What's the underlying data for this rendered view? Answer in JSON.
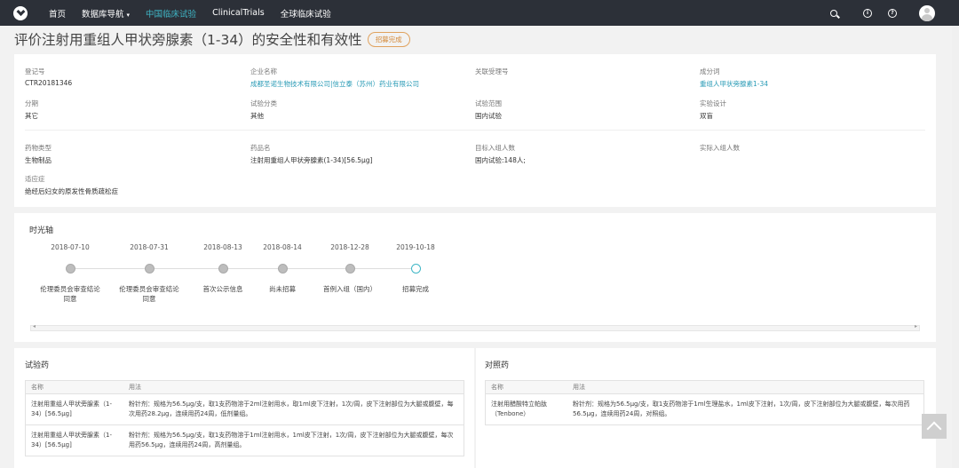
{
  "nav": {
    "home": "首页",
    "db_nav": "数据库导航",
    "china_trials": "中国临床试验",
    "clinicaltrials": "ClinicalTrials",
    "global_trials": "全球临床试验"
  },
  "page": {
    "title": "评价注射用重组人甲状旁腺素（1-34）的安全性和有效性",
    "status_badge": "招募完成"
  },
  "info": {
    "reg_no_label": "登记号",
    "reg_no": "CTR20181346",
    "company_label": "企业名称",
    "company": "成都圣诺生物技术有限公司|信立泰（苏州）药业有限公司",
    "related_label": "关联受理号",
    "component_label": "成分词",
    "component": "重组人甲状旁腺素1-34",
    "phase_label": "分期",
    "phase": "其它",
    "trial_type_label": "试验分类",
    "trial_type": "其他",
    "scope_label": "试验范围",
    "scope": "国内试验",
    "design_label": "实验设计",
    "design": "双盲",
    "drug_type_label": "药物类型",
    "drug_type": "生物制品",
    "drug_name_label": "药品名",
    "drug_name": "注射用重组人甲状旁腺素(1-34)[56.5μg]",
    "target_enroll_label": "目标入组人数",
    "target_enroll": "国内试验:148人;",
    "actual_enroll_label": "实际入组人数",
    "indication_label": "适应症",
    "indication": "绝经后妇女的原发性骨质疏松症"
  },
  "timeline": {
    "title": "时光轴",
    "events": [
      {
        "date": "2018-07-10",
        "text": "伦理委员会审查结论同意"
      },
      {
        "date": "2018-07-31",
        "text": "伦理委员会审查结论同意"
      },
      {
        "date": "2018-08-13",
        "text": "首次公示信息"
      },
      {
        "date": "2018-08-14",
        "text": "尚未招募"
      },
      {
        "date": "2018-12-28",
        "text": "首例入组（国内）"
      },
      {
        "date": "2019-10-18",
        "text": "招募完成"
      }
    ]
  },
  "trial_drugs": {
    "title": "试验药",
    "col_name": "名称",
    "col_usage": "用法",
    "rows": [
      {
        "name": "注射用重组人甲状旁腺素（1-34）[56.5μg]",
        "usage": "粉针剂：规格为56.5μg/支，取1支药物溶于2ml注射用水，取1ml皮下注射，1次/周，皮下注射部位为大腿或腹壁，每次用药28.2μg，连续用药24周，低剂量组。"
      },
      {
        "name": "注射用重组人甲状旁腺素（1-34）[56.5μg]",
        "usage": "粉针剂：规格为56.5μg/支，取1支药物溶于1ml注射用水，1ml皮下注射，1次/周，皮下注射部位为大腿或腹壁，每次用药56.5μg，连续用药24周，高剂量组。"
      }
    ]
  },
  "control_drugs": {
    "title": "对照药",
    "col_name": "名称",
    "col_usage": "用法",
    "rows": [
      {
        "name": "注射用醋酸特立帕肽（Tenbone）",
        "usage": "粉针剂：规格为56.5μg/支，取1支药物溶于1ml生理盐水，1ml皮下注射，1次/周，皮下注射部位为大腿或腹壁，每次用药56.5μg，连续用药24周，对照组。"
      }
    ]
  },
  "colors": {
    "nav_bg": "#2c3038",
    "accent": "#3fb6c6",
    "link": "#2a9bb6",
    "badge": "#d48a3a"
  }
}
